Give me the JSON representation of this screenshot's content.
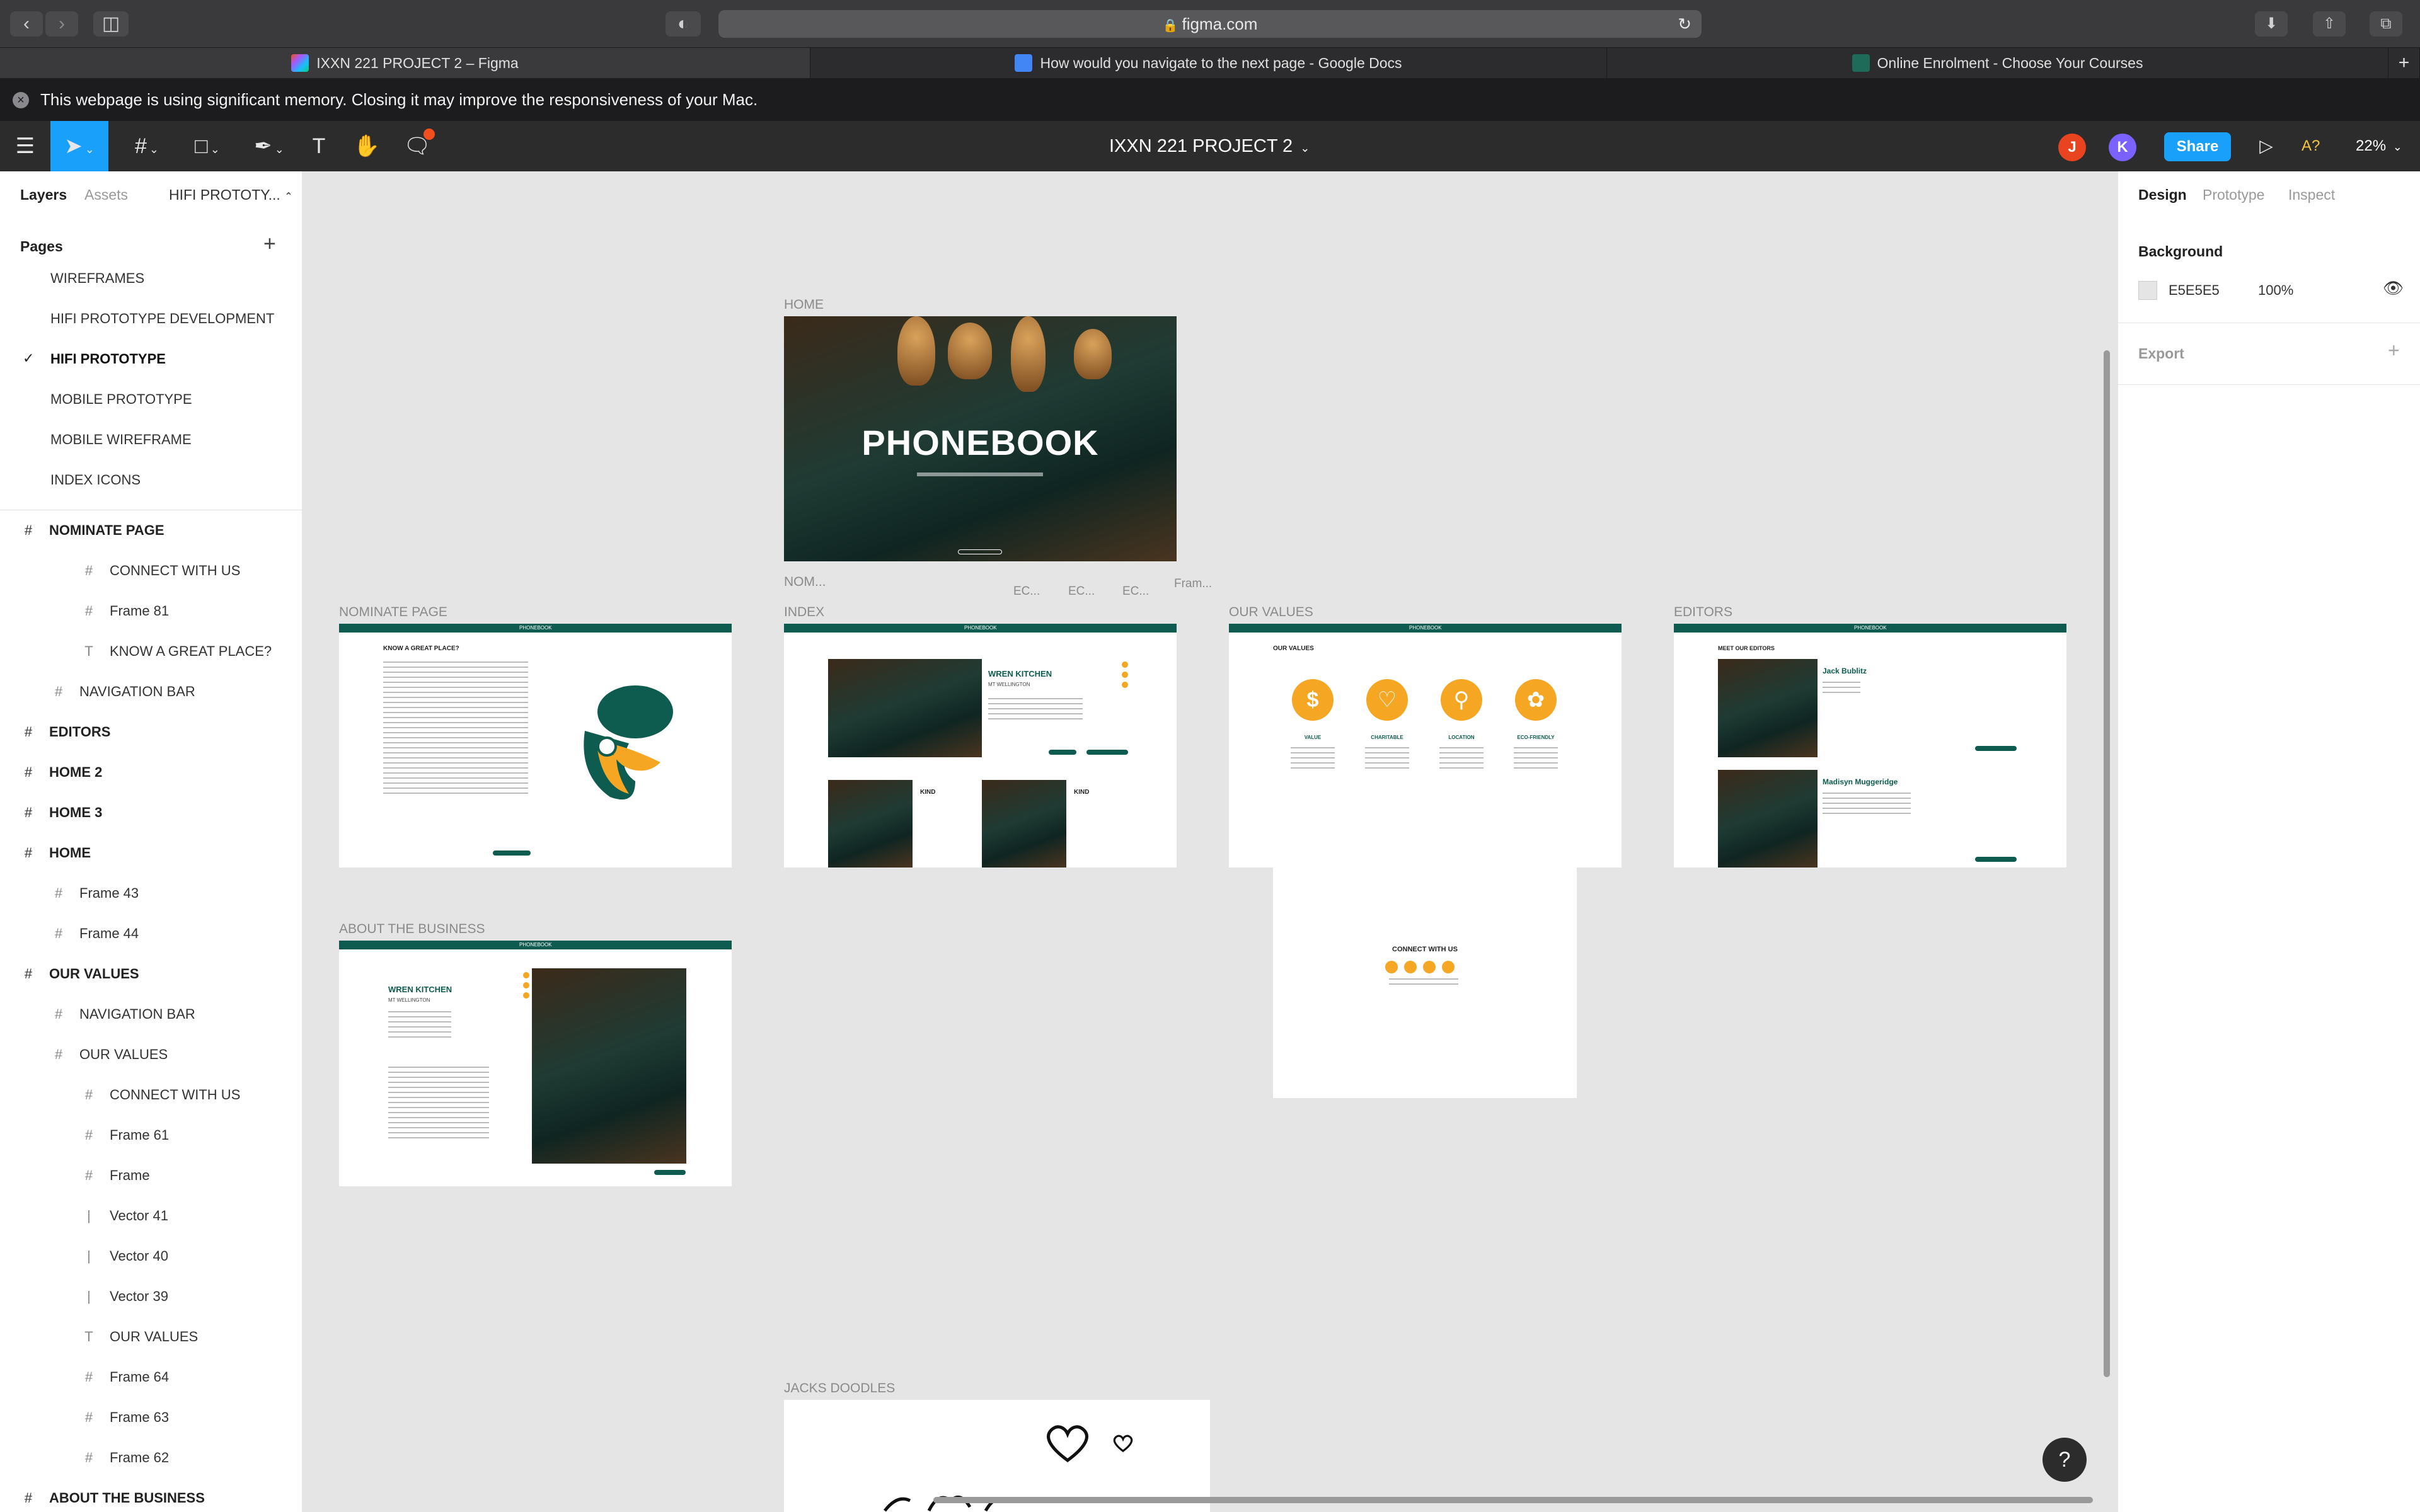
{
  "browser": {
    "url": "figma.com",
    "tabs": [
      {
        "title": "IXXN 221 PROJECT 2 – Figma",
        "icon": "figma-icon"
      },
      {
        "title": "How would you navigate to the next page - Google Docs",
        "icon": "google-docs-icon"
      },
      {
        "title": "Online Enrolment - Choose Your Courses",
        "icon": "enrolment-site-icon"
      }
    ],
    "memory_warning": "This webpage is using significant memory. Closing it may improve the responsiveness of your Mac."
  },
  "figma": {
    "document_title": "IXXN 221 PROJECT 2",
    "collaborators": [
      {
        "initial": "J",
        "color": "#e8441f"
      },
      {
        "initial": "K",
        "color": "#7b61ff"
      }
    ],
    "share_label": "Share",
    "a11y_label": "A?",
    "zoom": "22%"
  },
  "left_panel": {
    "tabs": [
      "Layers",
      "Assets"
    ],
    "current_page_tab": "HIFI PROTOTY...",
    "pages_heading": "Pages",
    "pages": [
      {
        "name": "WIREFRAMES",
        "current": false
      },
      {
        "name": "HIFI PROTOTYPE DEVELOPMENT",
        "current": false
      },
      {
        "name": "HIFI PROTOTYPE",
        "current": true
      },
      {
        "name": "MOBILE PROTOTYPE",
        "current": false
      },
      {
        "name": "MOBILE WIREFRAME",
        "current": false
      },
      {
        "name": "INDEX ICONS",
        "current": false
      }
    ],
    "layers": [
      {
        "name": "NOMINATE PAGE",
        "type": "frame",
        "depth": 0
      },
      {
        "name": "CONNECT WITH US",
        "type": "frame",
        "depth": 2
      },
      {
        "name": "Frame 81",
        "type": "frame",
        "depth": 2
      },
      {
        "name": "KNOW A GREAT PLACE?",
        "type": "text",
        "depth": 2
      },
      {
        "name": "NAVIGATION BAR",
        "type": "frame",
        "depth": 1
      },
      {
        "name": "EDITORS",
        "type": "frame",
        "depth": 0
      },
      {
        "name": "HOME 2",
        "type": "frame",
        "depth": 0
      },
      {
        "name": "HOME 3",
        "type": "frame",
        "depth": 0
      },
      {
        "name": "HOME",
        "type": "frame",
        "depth": 0
      },
      {
        "name": "Frame 43",
        "type": "frame",
        "depth": 1
      },
      {
        "name": "Frame 44",
        "type": "frame",
        "depth": 1
      },
      {
        "name": "OUR VALUES",
        "type": "frame",
        "depth": 0
      },
      {
        "name": "NAVIGATION BAR",
        "type": "frame",
        "depth": 1
      },
      {
        "name": "OUR VALUES",
        "type": "frame",
        "depth": 1
      },
      {
        "name": "CONNECT WITH US",
        "type": "frame",
        "depth": 2
      },
      {
        "name": "Frame 61",
        "type": "frame",
        "depth": 2
      },
      {
        "name": "Frame",
        "type": "frame",
        "depth": 2
      },
      {
        "name": "Vector 41",
        "type": "vector",
        "depth": 2
      },
      {
        "name": "Vector 40",
        "type": "vector",
        "depth": 2
      },
      {
        "name": "Vector 39",
        "type": "vector",
        "depth": 2
      },
      {
        "name": "OUR VALUES",
        "type": "text",
        "depth": 2
      },
      {
        "name": "Frame 64",
        "type": "frame",
        "depth": 2
      },
      {
        "name": "Frame 63",
        "type": "frame",
        "depth": 2
      },
      {
        "name": "Frame 62",
        "type": "frame",
        "depth": 2
      },
      {
        "name": "ABOUT THE BUSINESS",
        "type": "frame",
        "depth": 0
      }
    ]
  },
  "right_panel": {
    "tabs": [
      "Design",
      "Prototype",
      "Inspect"
    ],
    "background_heading": "Background",
    "background_hex": "E5E5E5",
    "background_opacity": "100%",
    "export_heading": "Export"
  },
  "canvas": {
    "frame_labels": {
      "home": "HOME",
      "nom_short": "NOM...",
      "ec1": "EC...",
      "ec2": "EC...",
      "ec3": "EC...",
      "fram_short": "Fram...",
      "nominate": "NOMINATE PAGE",
      "index": "INDEX",
      "our_values": "OUR VALUES",
      "editors": "EDITORS",
      "about": "ABOUT THE BUSINESS",
      "doodles": "JACKS DOODLES"
    },
    "home_hero_title": "PHONEBOOK",
    "brand": "PHONEBOOK",
    "nominate_heading": "KNOW A GREAT PLACE?",
    "index_business": "WREN KITCHEN",
    "index_business_sub": "MT WELLINGTON",
    "index_card_titles": [
      "KIND",
      "KIND"
    ],
    "values_heading": "OUR VALUES",
    "values": [
      {
        "label": "VALUE",
        "icon": "dollar-icon"
      },
      {
        "label": "CHARITABLE",
        "icon": "heart-icon"
      },
      {
        "label": "LOCATION",
        "icon": "location-pin-icon"
      },
      {
        "label": "ECO-FRIENDLY",
        "icon": "leaf-icon"
      }
    ],
    "editors_heading": "MEET OUR EDITORS",
    "editors": [
      "Jack Bublitz",
      "Madisyn Muggeridge"
    ],
    "about_business": "WREN KITCHEN",
    "about_sub": "MT WELLINGTON",
    "connect_heading": "CONNECT WITH US"
  }
}
